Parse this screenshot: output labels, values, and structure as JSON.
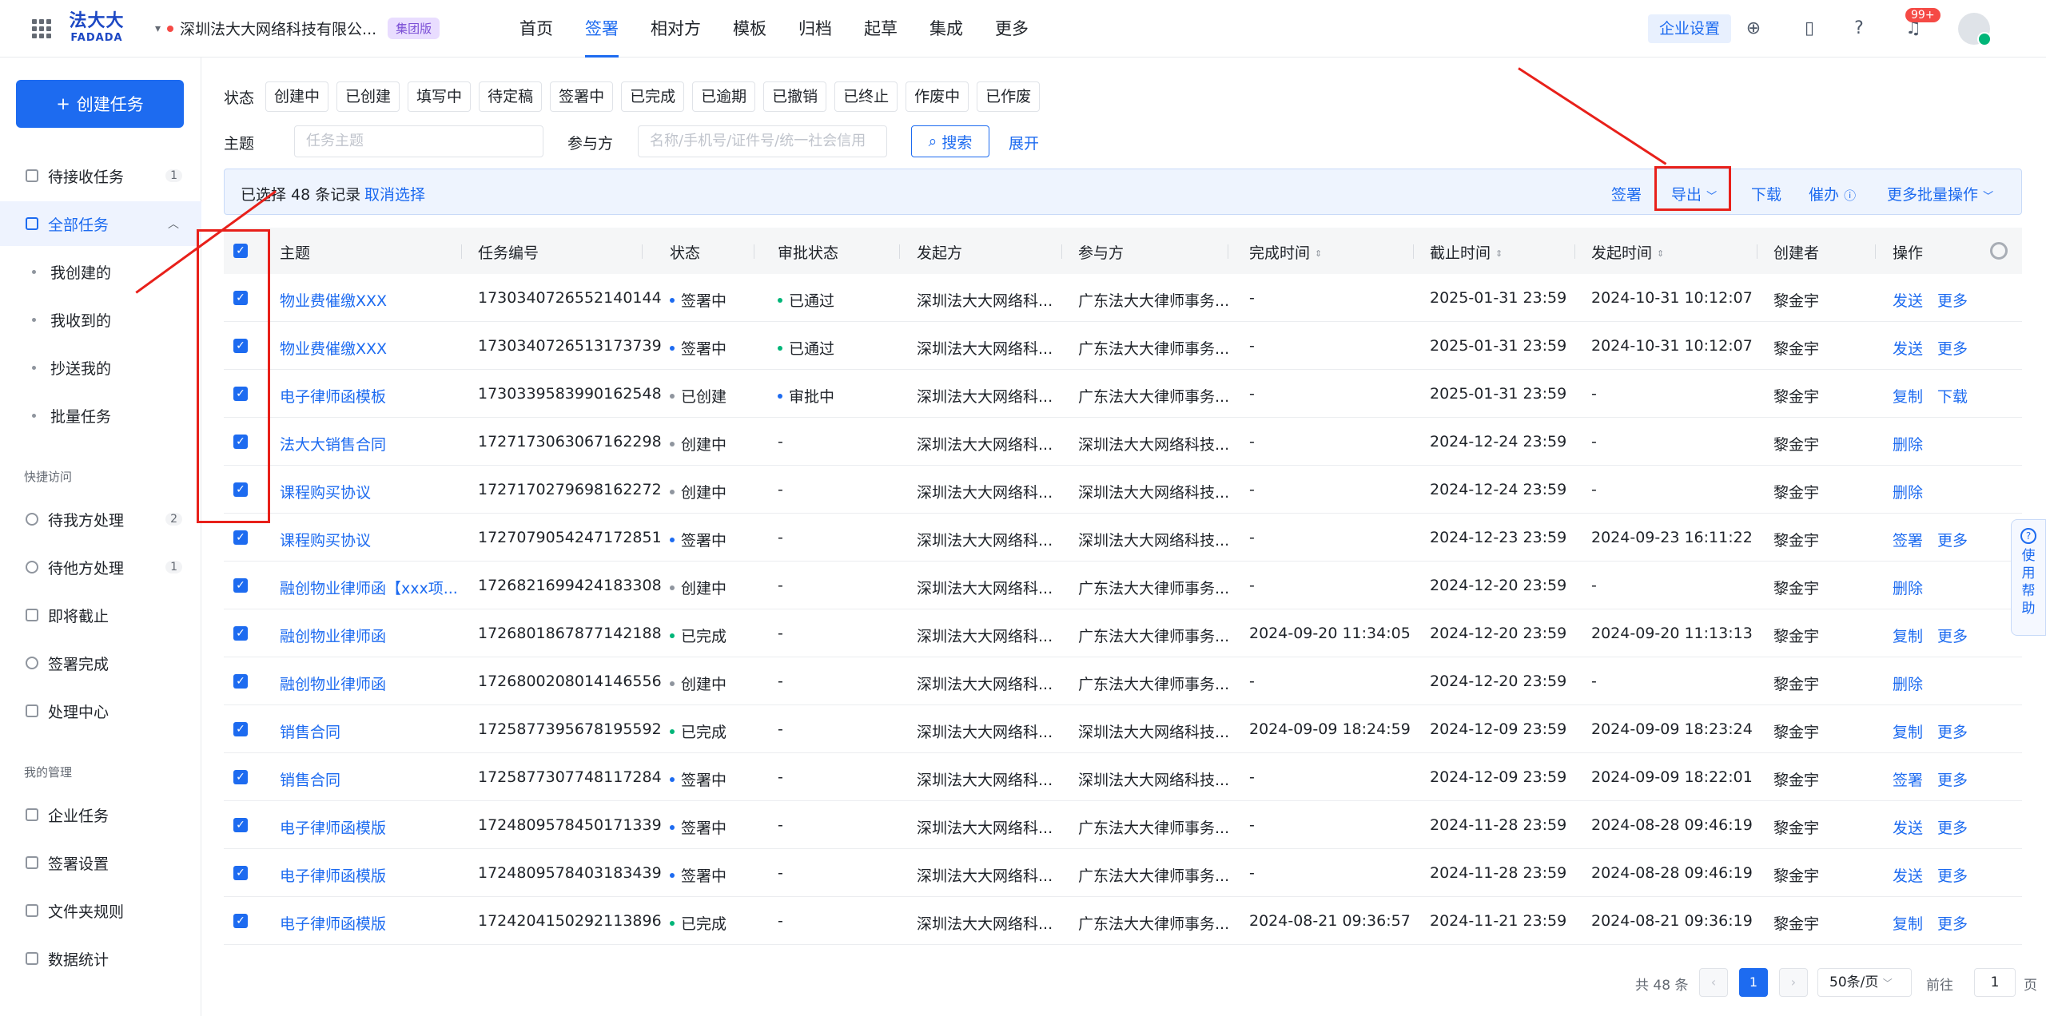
{
  "logo": {
    "cn": "法大大",
    "en": "FADADA"
  },
  "org": {
    "name": "深圳法大大网络科技有限公...",
    "badge": "集团版"
  },
  "nav": [
    "首页",
    "签署",
    "相对方",
    "模板",
    "归档",
    "起草",
    "集成",
    "更多"
  ],
  "topright": {
    "enterprise_settings": "企业设置",
    "notification_badge": "99+"
  },
  "sidebar": {
    "create_button": "创建任务",
    "items": [
      {
        "label": "待接收任务",
        "count": "1"
      },
      {
        "label": "全部任务"
      }
    ],
    "subitems": [
      "我创建的",
      "我收到的",
      "抄送我的",
      "批量任务"
    ],
    "quick_access_title": "快捷访问",
    "quick": [
      {
        "label": "待我方处理",
        "count": "2"
      },
      {
        "label": "待他方处理",
        "count": "1"
      },
      {
        "label": "即将截止"
      },
      {
        "label": "签署完成"
      },
      {
        "label": "处理中心"
      }
    ],
    "manage_title": "我的管理",
    "manage": [
      "企业任务",
      "签署设置",
      "文件夹规则",
      "数据统计"
    ]
  },
  "filters": {
    "status_label": "状态",
    "statuses": [
      "创建中",
      "已创建",
      "填写中",
      "待定稿",
      "签署中",
      "已完成",
      "已逾期",
      "已撤销",
      "已终止",
      "作废中",
      "已作废"
    ],
    "subject_label": "主题",
    "subject_placeholder": "任务主题",
    "party_label": "参与方",
    "party_placeholder": "名称/手机号/证件号/统一社会信用",
    "search_button": "搜索",
    "expand": "展开"
  },
  "selection_bar": {
    "selected_text": "已选择 48 条记录",
    "cancel": "取消选择",
    "actions": [
      "签署",
      "导出",
      "下载",
      "催办",
      "更多批量操作"
    ]
  },
  "table": {
    "columns": [
      "主题",
      "任务编号",
      "状态",
      "审批状态",
      "发起方",
      "参与方",
      "完成时间",
      "截止时间",
      "发起时间",
      "创建者",
      "操作"
    ],
    "rows": [
      {
        "subject": "物业费催缴XXX",
        "id": "1730340726552140144",
        "status": "签署中",
        "approval": "已通过",
        "initiator": "深圳法大大网络科...",
        "party": "广东法大大律师事务...",
        "done": "-",
        "deadline": "2025-01-31 23:59",
        "started": "2024-10-31 10:12:07",
        "creator": "黎金宇",
        "ops": [
          "发送",
          "更多"
        ]
      },
      {
        "subject": "物业费催缴XXX",
        "id": "1730340726513173739",
        "status": "签署中",
        "approval": "已通过",
        "initiator": "深圳法大大网络科...",
        "party": "广东法大大律师事务...",
        "done": "-",
        "deadline": "2025-01-31 23:59",
        "started": "2024-10-31 10:12:07",
        "creator": "黎金宇",
        "ops": [
          "发送",
          "更多"
        ]
      },
      {
        "subject": "电子律师函模板",
        "id": "1730339583990162548",
        "status": "已创建",
        "approval": "审批中",
        "initiator": "深圳法大大网络科...",
        "party": "广东法大大律师事务...",
        "done": "-",
        "deadline": "2025-01-31 23:59",
        "started": "-",
        "creator": "黎金宇",
        "ops": [
          "复制",
          "下载"
        ]
      },
      {
        "subject": "法大大销售合同",
        "id": "1727173063067162298",
        "status": "创建中",
        "approval": "-",
        "initiator": "深圳法大大网络科...",
        "party": "深圳法大大网络科技...",
        "done": "-",
        "deadline": "2024-12-24 23:59",
        "started": "-",
        "creator": "黎金宇",
        "ops": [
          "删除"
        ]
      },
      {
        "subject": "课程购买协议",
        "id": "1727170279698162272",
        "status": "创建中",
        "approval": "-",
        "initiator": "深圳法大大网络科...",
        "party": "深圳法大大网络科技...",
        "done": "-",
        "deadline": "2024-12-24 23:59",
        "started": "-",
        "creator": "黎金宇",
        "ops": [
          "删除"
        ]
      },
      {
        "subject": "课程购买协议",
        "id": "1727079054247172851",
        "status": "签署中",
        "approval": "-",
        "initiator": "深圳法大大网络科...",
        "party": "深圳法大大网络科技...",
        "done": "-",
        "deadline": "2024-12-23 23:59",
        "started": "2024-09-23 16:11:22",
        "creator": "黎金宇",
        "ops": [
          "签署",
          "更多"
        ]
      },
      {
        "subject": "融创物业律师函【xxx项...",
        "id": "1726821699424183308",
        "status": "创建中",
        "approval": "-",
        "initiator": "深圳法大大网络科...",
        "party": "广东法大大律师事务...",
        "done": "-",
        "deadline": "2024-12-20 23:59",
        "started": "-",
        "creator": "黎金宇",
        "ops": [
          "删除"
        ]
      },
      {
        "subject": "融创物业律师函",
        "id": "1726801867877142188",
        "status": "已完成",
        "approval": "-",
        "initiator": "深圳法大大网络科...",
        "party": "广东法大大律师事务...",
        "done": "2024-09-20 11:34:05",
        "deadline": "2024-12-20 23:59",
        "started": "2024-09-20 11:13:13",
        "creator": "黎金宇",
        "ops": [
          "复制",
          "更多"
        ]
      },
      {
        "subject": "融创物业律师函",
        "id": "1726800208014146556",
        "status": "创建中",
        "approval": "-",
        "initiator": "深圳法大大网络科...",
        "party": "广东法大大律师事务...",
        "done": "-",
        "deadline": "2024-12-20 23:59",
        "started": "-",
        "creator": "黎金宇",
        "ops": [
          "删除"
        ]
      },
      {
        "subject": "销售合同",
        "id": "1725877395678195592",
        "status": "已完成",
        "approval": "-",
        "initiator": "深圳法大大网络科...",
        "party": "深圳法大大网络科技...",
        "done": "2024-09-09 18:24:59",
        "deadline": "2024-12-09 23:59",
        "started": "2024-09-09 18:23:24",
        "creator": "黎金宇",
        "ops": [
          "复制",
          "更多"
        ]
      },
      {
        "subject": "销售合同",
        "id": "1725877307748117284",
        "status": "签署中",
        "approval": "-",
        "initiator": "深圳法大大网络科...",
        "party": "深圳法大大网络科技...",
        "done": "-",
        "deadline": "2024-12-09 23:59",
        "started": "2024-09-09 18:22:01",
        "creator": "黎金宇",
        "ops": [
          "签署",
          "更多"
        ]
      },
      {
        "subject": "电子律师函模版",
        "id": "1724809578450171339",
        "status": "签署中",
        "approval": "-",
        "initiator": "深圳法大大网络科...",
        "party": "广东法大大律师事务...",
        "done": "-",
        "deadline": "2024-11-28 23:59",
        "started": "2024-08-28 09:46:19",
        "creator": "黎金宇",
        "ops": [
          "发送",
          "更多"
        ]
      },
      {
        "subject": "电子律师函模版",
        "id": "1724809578403183439",
        "status": "签署中",
        "approval": "-",
        "initiator": "深圳法大大网络科...",
        "party": "广东法大大律师事务...",
        "done": "-",
        "deadline": "2024-11-28 23:59",
        "started": "2024-08-28 09:46:19",
        "creator": "黎金宇",
        "ops": [
          "发送",
          "更多"
        ]
      },
      {
        "subject": "电子律师函模版",
        "id": "1724204150292113896",
        "status": "已完成",
        "approval": "-",
        "initiator": "深圳法大大网络科...",
        "party": "广东法大大律师事务...",
        "done": "2024-08-21 09:36:57",
        "deadline": "2024-11-21 23:59",
        "started": "2024-08-21 09:36:19",
        "creator": "黎金宇",
        "ops": [
          "复制",
          "更多"
        ]
      }
    ]
  },
  "pagination": {
    "total": "共 48 条",
    "current": "1",
    "page_size": "50条/页",
    "jump_label": "前往",
    "jump_value": "1",
    "jump_suffix": "页"
  },
  "help": {
    "label": "使用帮助"
  },
  "colors": {
    "primary": "#1d6bf0",
    "status_signing": "#1d6bf0",
    "status_done": "#00b578",
    "status_created": "#8f959e",
    "highlight_red": "#e8201a"
  }
}
